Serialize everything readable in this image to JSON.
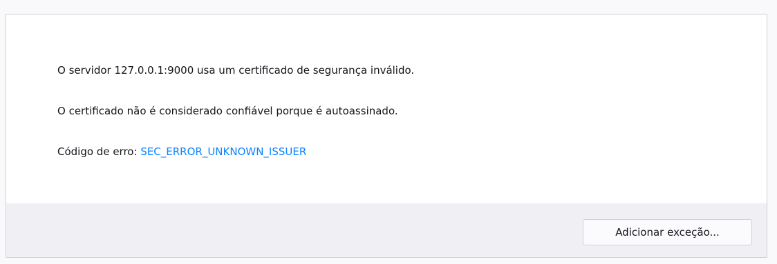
{
  "error_panel": {
    "line1": "O servidor 127.0.0.1:9000 usa um certificado de segurança inválido.",
    "line2": "O certificado não é considerado confiável porque é autoassinado.",
    "error_code_label": "Código de erro: ",
    "error_code": "SEC_ERROR_UNKNOWN_ISSUER",
    "link_color": "#0a84ff"
  },
  "footer": {
    "add_exception_label": "Adicionar exceção..."
  }
}
